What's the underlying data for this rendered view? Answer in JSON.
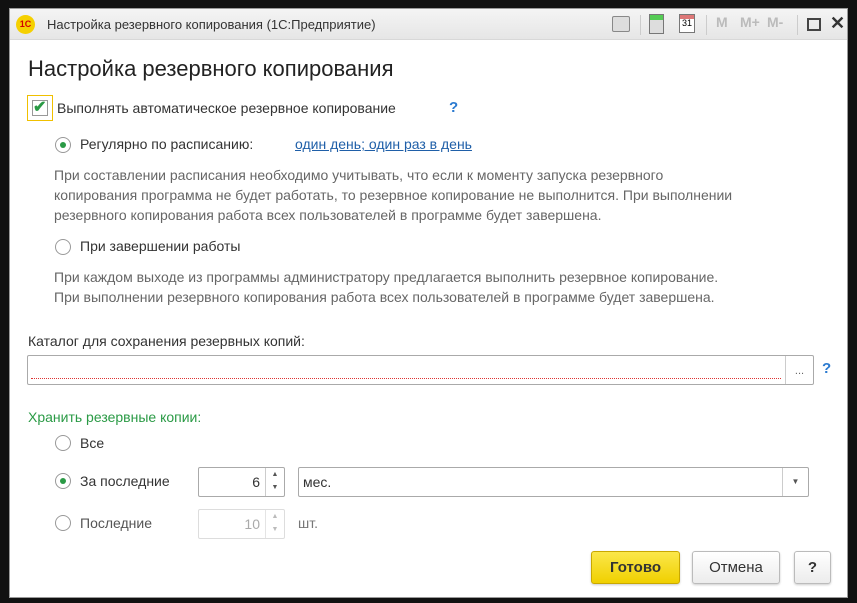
{
  "window": {
    "title": "Настройка резервного копирования  (1С:Предприятие)",
    "logo": "1С",
    "toolbar": [
      "print-icon",
      "calculator-icon",
      "calendar-icon",
      "M",
      "M+",
      "M-",
      "maximize-icon",
      "close-icon"
    ]
  },
  "heading": "Настройка резервного копирования",
  "auto_backup": {
    "label": "Выполнять автоматическое резервное копирование",
    "checked": true,
    "help": "?"
  },
  "schedule": {
    "label": "Регулярно по расписанию:",
    "link": "один день; один раз в день",
    "selected": true,
    "hint": [
      "При составлении расписания необходимо учитывать, что если к моменту запуска резервного",
      "копирования программа не будет работать, то резервное копирование не выполнится. При выполнении",
      "резервного копирования работа всех пользователей в программе будет завершена."
    ]
  },
  "on_exit": {
    "label": "При завершении работы",
    "selected": false,
    "hint": [
      "При каждом выходе из программы администратору предлагается выполнить резервное копирование.",
      "При выполнении резервного копирования работа всех пользователей в программе будет завершена."
    ]
  },
  "directory": {
    "label": "Каталог для сохранения резервных копий:",
    "value": "",
    "browse": "...",
    "help": "?"
  },
  "keep": {
    "label": "Хранить резервные копии:",
    "options": [
      {
        "label": "Все",
        "selected": false
      },
      {
        "label": "За последние",
        "selected": true,
        "value": "6",
        "unit": "мес."
      },
      {
        "label": "Последние",
        "selected": false,
        "value": "10",
        "unit": "шт."
      }
    ]
  },
  "buttons": {
    "ok": "Готово",
    "cancel": "Отмена",
    "help": "?"
  },
  "colors": {
    "accent_green": "#2a9a45",
    "link": "#1f5fa8",
    "ok_button": "#f5d800"
  }
}
